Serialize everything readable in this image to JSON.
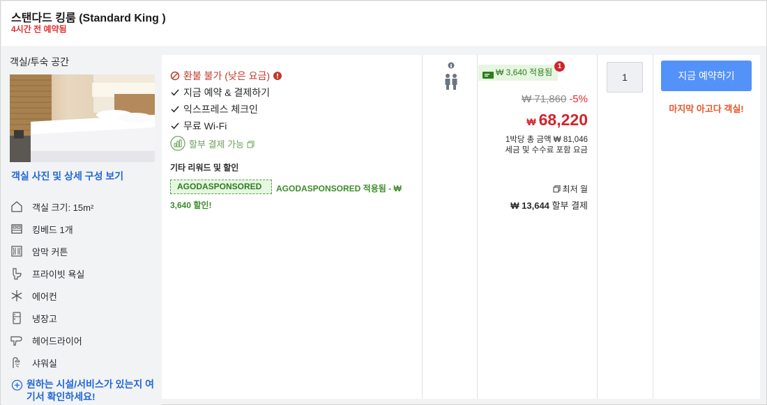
{
  "header": {
    "room_title": "스탠다드 킹룸 (Standard King )",
    "booked_text": "4시간 전 예약됨"
  },
  "left": {
    "section_label": "객실/투숙 공간",
    "view_link": "객실 사진 및 상세 구성 보기",
    "amenities": [
      {
        "icon": "house-icon",
        "label": "객실 크기: 15m²"
      },
      {
        "icon": "bed-icon",
        "label": "킹베드 1개"
      },
      {
        "icon": "curtain-icon",
        "label": "암막 커튼"
      },
      {
        "icon": "toilet-icon",
        "label": "프라이빗 욕실"
      },
      {
        "icon": "snowflake-icon",
        "label": "에어컨"
      },
      {
        "icon": "fridge-icon",
        "label": "냉장고"
      },
      {
        "icon": "hairdryer-icon",
        "label": "헤어드라이어"
      },
      {
        "icon": "shower-icon",
        "label": "샤워실"
      }
    ],
    "more_link": "원하는 시설/서비스가 있는지 여기서 확인하세요!"
  },
  "benefits": {
    "refund": "환불 불가 (낮은 요금)",
    "items": [
      "지금 예약 & 결제하기",
      "익스프레스 체크인",
      "무료 Wi-Fi"
    ],
    "installment": "할부 결제 가능",
    "rewards_title": "기타 리워드 및 할인",
    "promo_code": "AGODASPONSORED",
    "promo_text": "AGODASPONSORED 적용됨 - ₩ 3,640 할인!"
  },
  "price": {
    "coupon": "₩ 3,640 적용됨",
    "coupon_badge": "1",
    "original": "₩ 71,860",
    "discount": "-5%",
    "currency": "₩",
    "final": "68,220",
    "per_night": "1박당 총 금액 ₩ 81,046",
    "tax_note": "세금 및 수수료 포함 요금",
    "min_month": "최저 월",
    "monthly_amount": "₩ 13,644",
    "monthly_suffix": "할부 결제"
  },
  "booking": {
    "quantity": "1",
    "book_button": "지금 예약하기",
    "urgency": "마지막 아고다 객실!"
  },
  "colors": {
    "accent_blue": "#5392f9",
    "price_red": "#d0242b",
    "promo_green": "#2e7d1f",
    "urgency_orange": "#e4562a"
  }
}
